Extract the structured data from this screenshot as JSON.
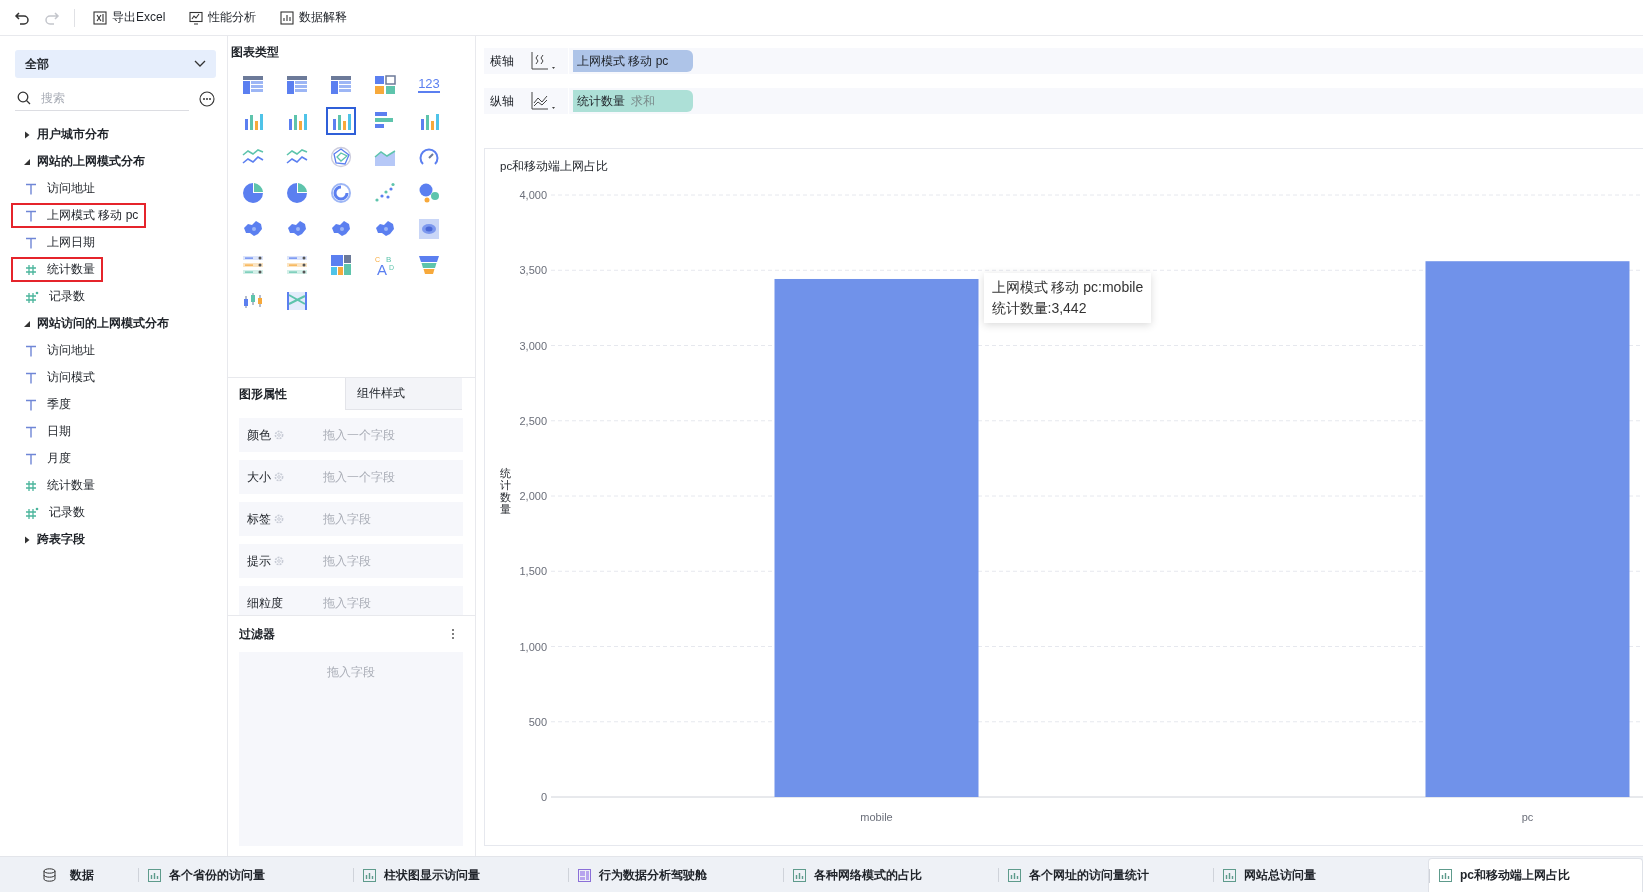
{
  "toolbar": {
    "history": [
      {
        "kind": "undo",
        "disabled": false
      },
      {
        "kind": "redo",
        "disabled": true
      }
    ],
    "actions": [
      {
        "kind": "excel",
        "label": "导出Excel"
      },
      {
        "kind": "performance",
        "label": "性能分析"
      },
      {
        "kind": "explain",
        "label": "数据解释"
      }
    ]
  },
  "field_panel": {
    "scope": "全部",
    "search": {
      "placeholder": "搜索"
    },
    "tree": [
      {
        "label": "用户城市分布",
        "expanded": false
      },
      {
        "label": "网站的上网模式分布",
        "expanded": true,
        "children": [
          {
            "label": "访问地址",
            "kind": "dimension",
            "highlighted": false
          },
          {
            "label": "上网模式 移动 pc",
            "kind": "dimension",
            "highlighted": true
          },
          {
            "label": "上网日期",
            "kind": "dimension",
            "highlighted": false
          },
          {
            "label": "统计数量",
            "kind": "measure",
            "highlighted": true
          },
          {
            "label": "记录数",
            "kind": "record",
            "highlighted": false
          }
        ]
      },
      {
        "label": "网站访问的上网模式分布",
        "expanded": true,
        "children": [
          {
            "label": "访问地址",
            "kind": "dimension",
            "highlighted": false
          },
          {
            "label": "访问模式",
            "kind": "dimension",
            "highlighted": false
          },
          {
            "label": "季度",
            "kind": "dimension",
            "highlighted": false
          },
          {
            "label": "日期",
            "kind": "dimension",
            "highlighted": false
          },
          {
            "label": "月度",
            "kind": "dimension",
            "highlighted": false
          },
          {
            "label": "统计数量",
            "kind": "measure",
            "highlighted": false
          },
          {
            "label": "记录数",
            "kind": "record",
            "highlighted": false
          }
        ]
      },
      {
        "label": "跨表字段",
        "expanded": false
      }
    ]
  },
  "chart_types": {
    "title": "图表类型",
    "items": [
      {
        "kind": "table",
        "selected": false
      },
      {
        "kind": "table",
        "selected": false
      },
      {
        "kind": "table",
        "selected": false
      },
      {
        "kind": "blocks",
        "selected": false
      },
      {
        "kind": "number",
        "label": "123",
        "selected": false
      },
      {
        "kind": "bars",
        "selected": false
      },
      {
        "kind": "bars",
        "selected": false
      },
      {
        "kind": "bars",
        "selected": true
      },
      {
        "kind": "hbars",
        "selected": false
      },
      {
        "kind": "bars",
        "selected": false
      },
      {
        "kind": "lines",
        "selected": false
      },
      {
        "kind": "lines",
        "selected": false
      },
      {
        "kind": "radar",
        "selected": false
      },
      {
        "kind": "area",
        "selected": false
      },
      {
        "kind": "gauge",
        "selected": false
      },
      {
        "kind": "pie",
        "selected": false
      },
      {
        "kind": "pie",
        "selected": false
      },
      {
        "kind": "donut",
        "selected": false
      },
      {
        "kind": "scatter",
        "selected": false
      },
      {
        "kind": "bubble",
        "selected": false
      },
      {
        "kind": "map",
        "selected": false
      },
      {
        "kind": "map",
        "selected": false
      },
      {
        "kind": "map",
        "selected": false
      },
      {
        "kind": "map",
        "selected": false
      },
      {
        "kind": "heatmap",
        "selected": false
      },
      {
        "kind": "ranklist",
        "selected": false
      },
      {
        "kind": "ranklist",
        "selected": false
      },
      {
        "kind": "treemap",
        "selected": false
      },
      {
        "kind": "wordcloud",
        "label": "CABD",
        "selected": false
      },
      {
        "kind": "funnel",
        "selected": false
      },
      {
        "kind": "candles",
        "selected": false
      },
      {
        "kind": "sankey",
        "selected": false
      }
    ]
  },
  "property_tabs": [
    {
      "label": "图形属性",
      "selected": true
    },
    {
      "label": "组件样式",
      "selected": false
    }
  ],
  "properties": [
    {
      "label": "颜色",
      "placeholder": "拖入一个字段",
      "configurable": true
    },
    {
      "label": "大小",
      "placeholder": "拖入一个字段",
      "configurable": true
    },
    {
      "label": "标签",
      "placeholder": "拖入字段",
      "configurable": true
    },
    {
      "label": "提示",
      "placeholder": "拖入字段",
      "configurable": true
    },
    {
      "label": "细粒度",
      "placeholder": "拖入字段",
      "configurable": false
    }
  ],
  "filter": {
    "title": "过滤器",
    "placeholder": "拖入字段"
  },
  "axes": [
    {
      "label": "横轴",
      "kind": "x",
      "field": "上网模式 移动 pc",
      "color": "#aec4e8"
    },
    {
      "label": "纵轴",
      "kind": "y",
      "field": "统计数量",
      "aggregate": "求和",
      "color": "#ade0d7"
    }
  ],
  "chart": {
    "chart_data": {
      "type": "bar",
      "title": "pc和移动端上网占比",
      "ylabel": "统计数量",
      "categories": [
        "mobile",
        "pc"
      ],
      "series": [
        {
          "color": "#7092ea",
          "values": [
            3442,
            3560
          ]
        }
      ],
      "grid": true,
      "ylim": [
        0,
        4000
      ],
      "yticks": [
        {
          "value": 0,
          "label": "0"
        },
        {
          "value": 500,
          "label": "500"
        },
        {
          "value": 1000,
          "label": "1,000"
        },
        {
          "value": 1500,
          "label": "1,500"
        },
        {
          "value": 2000,
          "label": "2,000"
        },
        {
          "value": 2500,
          "label": "2,500"
        },
        {
          "value": 3000,
          "label": "3,000"
        },
        {
          "value": 3500,
          "label": "3,500"
        },
        {
          "value": 4000,
          "label": "4,000"
        }
      ]
    },
    "tooltip": {
      "lines": [
        "上网模式 移动 pc:mobile",
        "统计数量:3,442"
      ]
    }
  },
  "sheets": [
    {
      "label": "数据",
      "kind": "data",
      "selected": false
    },
    {
      "label": "各个省份的访问量",
      "kind": "chart",
      "selected": false
    },
    {
      "label": "柱状图显示访问量",
      "kind": "chart",
      "selected": false
    },
    {
      "label": "行为数据分析驾驶舱",
      "kind": "dashboard",
      "selected": false
    },
    {
      "label": "各种网络模式的占比",
      "kind": "chart",
      "selected": false
    },
    {
      "label": "各个网址的访问量统计",
      "kind": "chart",
      "selected": false
    },
    {
      "label": "网站总访问量",
      "kind": "chart",
      "selected": false
    },
    {
      "label": "pc和移动端上网占比",
      "kind": "chart",
      "selected": true
    }
  ]
}
